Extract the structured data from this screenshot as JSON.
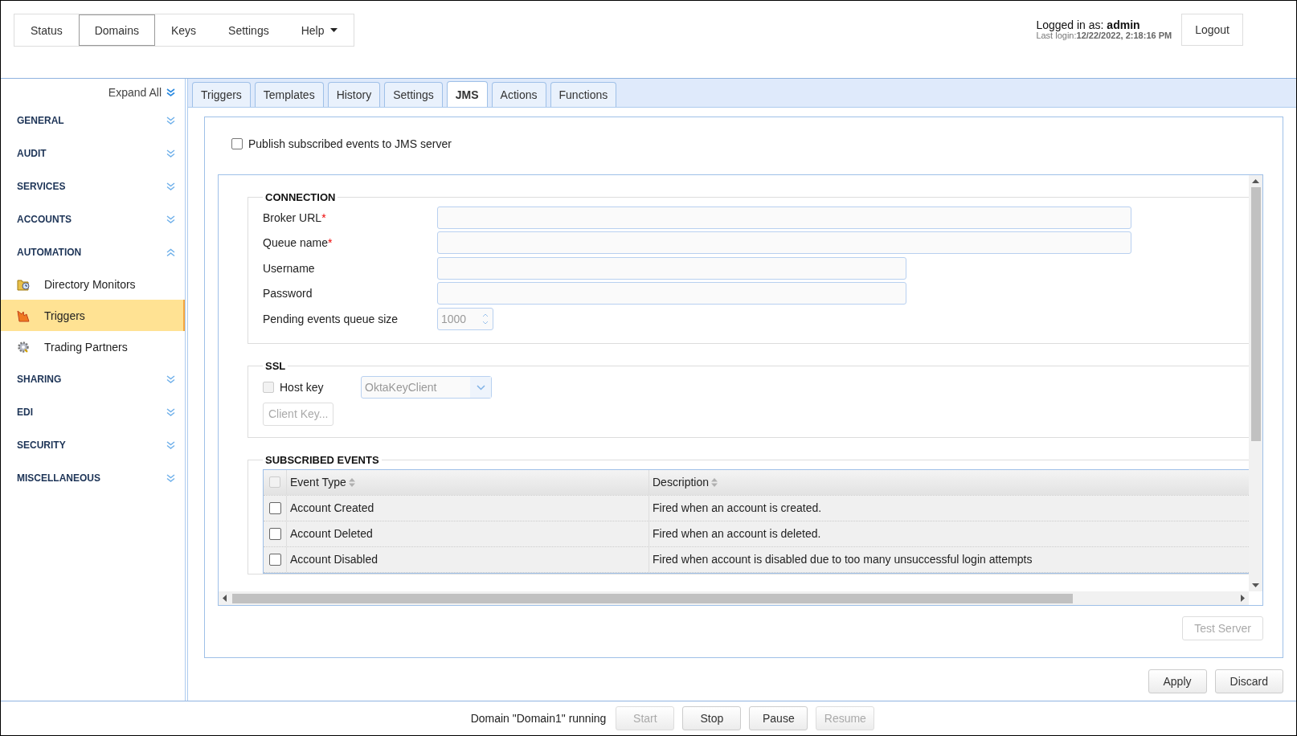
{
  "nav": [
    {
      "label": "Status",
      "selected": false,
      "has_menu": false
    },
    {
      "label": "Domains",
      "selected": true,
      "has_menu": false
    },
    {
      "label": "Keys",
      "selected": false,
      "has_menu": false
    },
    {
      "label": "Settings",
      "selected": false,
      "has_menu": false
    },
    {
      "label": "Help",
      "selected": false,
      "has_menu": true
    }
  ],
  "user": {
    "logged_in_label": "Logged in as:",
    "username": "admin",
    "last_login_label": "Last login:",
    "last_login": "12/22/2022, 2:18:16 PM",
    "logout_button": "Logout"
  },
  "sidebar": {
    "expand_all": "Expand All",
    "sections": [
      {
        "label": "GENERAL",
        "expanded": false
      },
      {
        "label": "AUDIT",
        "expanded": false
      },
      {
        "label": "SERVICES",
        "expanded": false
      },
      {
        "label": "ACCOUNTS",
        "expanded": false
      },
      {
        "label": "AUTOMATION",
        "expanded": true,
        "children": [
          {
            "label": "Directory Monitors",
            "selected": false,
            "kind": "folder"
          },
          {
            "label": "Triggers",
            "selected": true,
            "kind": "trigger"
          },
          {
            "label": "Trading Partners",
            "selected": false,
            "kind": "gear"
          }
        ]
      },
      {
        "label": "SHARING",
        "expanded": false
      },
      {
        "label": "EDI",
        "expanded": false
      },
      {
        "label": "SECURITY",
        "expanded": false
      },
      {
        "label": "MISCELLANEOUS",
        "expanded": false
      }
    ]
  },
  "tabs": [
    {
      "label": "Triggers",
      "selected": false
    },
    {
      "label": "Templates",
      "selected": false
    },
    {
      "label": "History",
      "selected": false
    },
    {
      "label": "Settings",
      "selected": false
    },
    {
      "label": "JMS",
      "selected": true
    },
    {
      "label": "Actions",
      "selected": false
    },
    {
      "label": "Functions",
      "selected": false
    }
  ],
  "publish": {
    "label": "Publish subscribed events to JMS server",
    "checked": false
  },
  "connection": {
    "title": "CONNECTION",
    "fields": [
      {
        "label": "Broker URL",
        "required_mark": "*",
        "kind": "text"
      },
      {
        "label": "Queue name",
        "required_mark": "*",
        "kind": "text"
      },
      {
        "label": "Username",
        "kind": "text"
      },
      {
        "label": "Password",
        "kind": "text"
      },
      {
        "label": "Pending events queue size",
        "kind": "number",
        "value": "1000"
      }
    ]
  },
  "ssl": {
    "title": "SSL",
    "host_key": {
      "label": "Host key",
      "checked": false,
      "disabled": true
    },
    "select": {
      "value": "OktaKeyClient",
      "disabled": true
    },
    "client_key_button": {
      "label": "Client Key...",
      "disabled": true
    }
  },
  "events": {
    "title": "SUBSCRIBED EVENTS",
    "columns": [
      "Event Type",
      "Description"
    ],
    "header_checked": false,
    "rows": [
      {
        "event_type": "Account Created",
        "description": "Fired when an account is created.",
        "checked": false
      },
      {
        "event_type": "Account Deleted",
        "description": "Fired when an account is deleted.",
        "checked": false
      },
      {
        "event_type": "Account Disabled",
        "description": "Fired when account is disabled due to too many unsuccessful login attempts",
        "checked": false
      }
    ]
  },
  "test_server_button": {
    "label": "Test Server",
    "disabled": true
  },
  "actions": [
    {
      "label": "Apply",
      "disabled": false
    },
    {
      "label": "Discard",
      "disabled": false
    }
  ],
  "footer": {
    "status": "Domain \"Domain1\" running",
    "buttons": [
      {
        "label": "Start",
        "disabled": true
      },
      {
        "label": "Stop",
        "disabled": false
      },
      {
        "label": "Pause",
        "disabled": false
      },
      {
        "label": "Resume",
        "disabled": true
      }
    ]
  }
}
